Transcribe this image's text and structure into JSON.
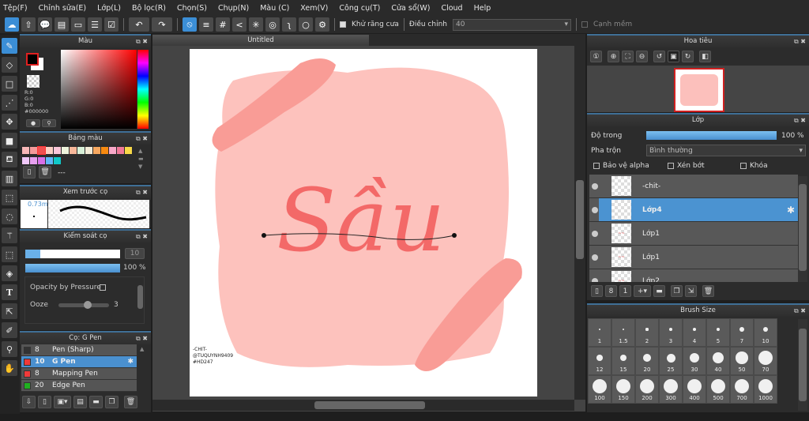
{
  "menu": [
    "Tệp(F)",
    "Chỉnh sửa(E)",
    "Lớp(L)",
    "Bộ lọc(R)",
    "Chọn(S)",
    "Chụp(N)",
    "Màu (C)",
    "Xem(V)",
    "Công cụ(T)",
    "Cửa sổ(W)",
    "Cloud",
    "Help"
  ],
  "toolbar": {
    "antialias_label": "Khử răng cưa",
    "correction_label": "Điều chỉnh",
    "correction_value": "40",
    "soft_edge_label": "Cạnh mềm",
    "antialias_checked": true,
    "soft_edge_checked": false
  },
  "color_panel": {
    "title": "Màu",
    "r": "R:0",
    "g": "G:0",
    "b": "B:0",
    "hex": "#000000",
    "fg": "#000000",
    "bg": "#ffffff"
  },
  "palette_panel": {
    "title": "Bảng màu",
    "colors": [
      "#f8b8b8",
      "#f49a9a",
      "#f05050",
      "#fbd0c4",
      "#fbc6d8",
      "#eef4dc",
      "#f8b89a",
      "#d8f0d8",
      "#f4ecd8",
      "#f8a860",
      "#f88a10",
      "#f8a8c8",
      "#f07898",
      "#f8d848",
      "#f0c8f8",
      "#e8a0f0",
      "#d870e8",
      "#60b8f8",
      "#10c8c8"
    ],
    "name": "---"
  },
  "preview_panel": {
    "title": "Xem trước cọ",
    "size": "0.73mm"
  },
  "brush_control": {
    "title": "Kiểm soát cọ",
    "size": "10",
    "size_fraction": 0.16,
    "opacity": "100 %",
    "opacity_fraction": 1.0,
    "opacity_by_pressure": "Opacity by Pressure",
    "ooze_label": "Ooze",
    "ooze_value": "3"
  },
  "brush_panel": {
    "title": "Cọ: G Pen",
    "items": [
      {
        "size": "8",
        "name": "Pen (Sharp)",
        "color": "#333333"
      },
      {
        "size": "10",
        "name": "G Pen",
        "color": "#f03a3a",
        "selected": true
      },
      {
        "size": "8",
        "name": "Mapping Pen",
        "color": "#f03a3a"
      },
      {
        "size": "20",
        "name": "Edge Pen",
        "color": "#20b020"
      }
    ]
  },
  "document": {
    "tab": "Untitled",
    "artwork_text": "Sầu",
    "signature": [
      "-CHIT-",
      "@TUQUYNH9409",
      "#HD247"
    ]
  },
  "navigator": {
    "title": "Hoa tiêu"
  },
  "layers": {
    "title": "Lớp",
    "opacity_label": "Độ trong",
    "opacity": "100 %",
    "opacity_fraction": 1.0,
    "blend_label": "Pha trộn",
    "blend": "Bình thường",
    "protect_alpha": "Bảo vệ alpha",
    "clipping": "Xén bớt",
    "lock": "Khóa",
    "items": [
      {
        "name": "-chit-"
      },
      {
        "name": "Lớp4",
        "selected": true
      },
      {
        "name": "Lớp1"
      },
      {
        "name": "Lớp1"
      },
      {
        "name": "Lớp2"
      }
    ]
  },
  "brush_size": {
    "title": "Brush Size",
    "sizes": [
      "1",
      "1.5",
      "2",
      "3",
      "4",
      "5",
      "7",
      "10",
      "12",
      "15",
      "20",
      "25",
      "30",
      "40",
      "50",
      "70",
      "100",
      "150",
      "200",
      "300",
      "400",
      "500",
      "700",
      "1000"
    ]
  }
}
